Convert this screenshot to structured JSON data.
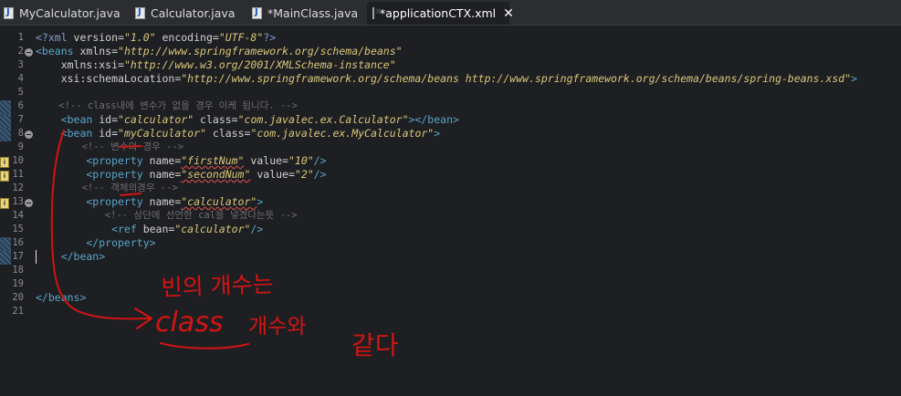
{
  "tabs": [
    {
      "label": "MyCalculator.java",
      "icon": "java-file-icon",
      "active": false
    },
    {
      "label": "Calculator.java",
      "icon": "java-file-icon",
      "active": false
    },
    {
      "label": "*MainClass.java",
      "icon": "java-file-icon",
      "active": false
    },
    {
      "label": "*applicationCTX.xml",
      "icon": "xml-file-icon",
      "active": true
    }
  ],
  "close_glyph": "✕",
  "editor": {
    "line_numbers": [
      "1",
      "2",
      "3",
      "4",
      "5",
      "6",
      "7",
      "8",
      "9",
      "10",
      "11",
      "12",
      "13",
      "14",
      "15",
      "16",
      "17",
      "18",
      "19",
      "20",
      "21"
    ],
    "lines": {
      "l1": {
        "t1": "<?xml ",
        "t2": "version=",
        "t3": "\"1.0\"",
        "t4": " encoding=",
        "t5": "\"UTF-8\"",
        "t6": "?>"
      },
      "l2": {
        "t1": "<beans ",
        "t2": "xmlns=",
        "t3": "\"http://www.springframework.org/schema/beans\""
      },
      "l3": {
        "t1": "    xmlns:xsi=",
        "t2": "\"http://www.w3.org/2001/XMLSchema-instance\""
      },
      "l4": {
        "t1": "    xsi:schemaLocation=",
        "t2": "\"http://www.springframework.org/schema/beans http://www.springframework.org/schema/beans/spring-beans.xsd\"",
        "t3": ">"
      },
      "l6": {
        "t1": "    <!-- class내에 변수가 없을 경우 이케 됩니다. -->"
      },
      "l7": {
        "t1": "    <bean ",
        "t2": "id=",
        "t3": "\"calculator\"",
        "t4": " class=",
        "t5": "\"com.javalec.ex.Calculator\"",
        "t6": "></bean>"
      },
      "l8": {
        "t1": "    <bean ",
        "t2": "id=",
        "t3": "\"myCalculator\"",
        "t4": " class=",
        "t5": "\"com.javalec.ex.MyCalculator\"",
        "t6": ">"
      },
      "l9": {
        "t1": "        <!-- 변수의 경우 -->"
      },
      "l10": {
        "t1": "        <property ",
        "t2": "name=",
        "t3": "\"firstNum\"",
        "t4": " value=",
        "t5": "\"10\"",
        "t6": "/>"
      },
      "l11": {
        "t1": "        <property ",
        "t2": "name=",
        "t3": "\"secondNum\"",
        "t4": " value=",
        "t5": "\"2\"",
        "t6": "/>"
      },
      "l12": {
        "t1": "        <!-- 객체의경우 -->"
      },
      "l13": {
        "t1": "        <property ",
        "t2": "name=",
        "t3": "\"calculator\"",
        "t4": ">"
      },
      "l14": {
        "t1": "            <!-- 상단에 선언한 cal을 넣겠다는뜻 -->"
      },
      "l15": {
        "t1": "            <ref ",
        "t2": "bean=",
        "t3": "\"calculator\"",
        "t4": "/>"
      },
      "l16": {
        "t1": "        </property>"
      },
      "l17": {
        "t1": "    </bean>"
      },
      "l20": {
        "t1": "</beans>"
      }
    }
  },
  "annotation": {
    "line1": "빈의 개수는",
    "line2a": "class",
    "line2b": "개수와",
    "line2c": "같다",
    "color": "#d21414"
  }
}
